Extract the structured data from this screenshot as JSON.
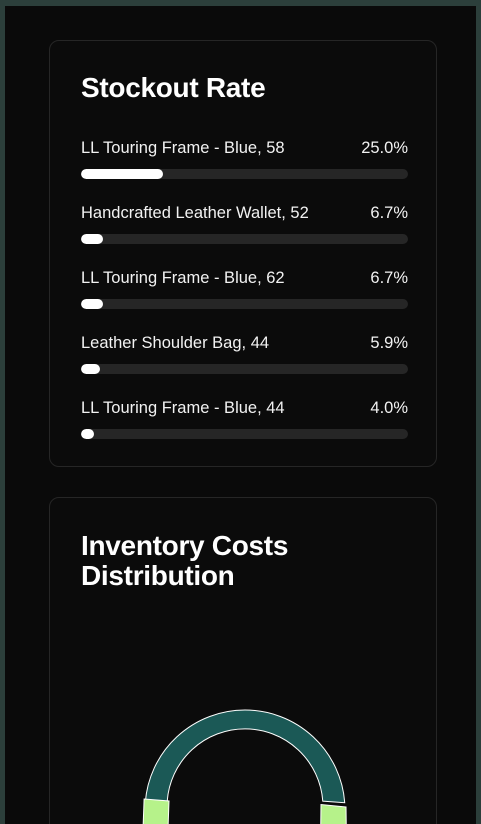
{
  "stockout": {
    "title": "Stockout Rate",
    "items": [
      {
        "label": "LL Touring Frame - Blue, 58",
        "value": "25.0%",
        "fraction": 0.25
      },
      {
        "label": "Handcrafted Leather Wallet, 52",
        "value": "6.7%",
        "fraction": 0.067
      },
      {
        "label": "LL Touring Frame - Blue, 62",
        "value": "6.7%",
        "fraction": 0.067
      },
      {
        "label": "Leather Shoulder Bag, 44",
        "value": "5.9%",
        "fraction": 0.059
      },
      {
        "label": "LL Touring Frame - Blue, 44",
        "value": "4.0%",
        "fraction": 0.04
      }
    ]
  },
  "inventory": {
    "title_line1": "Inventory Costs",
    "title_line2": "Distribution"
  },
  "colors": {
    "primary_segment": "#1b5956",
    "secondary_segment": "#b6f28a",
    "bar_fill": "#ffffff",
    "bar_track": "#262626"
  }
}
